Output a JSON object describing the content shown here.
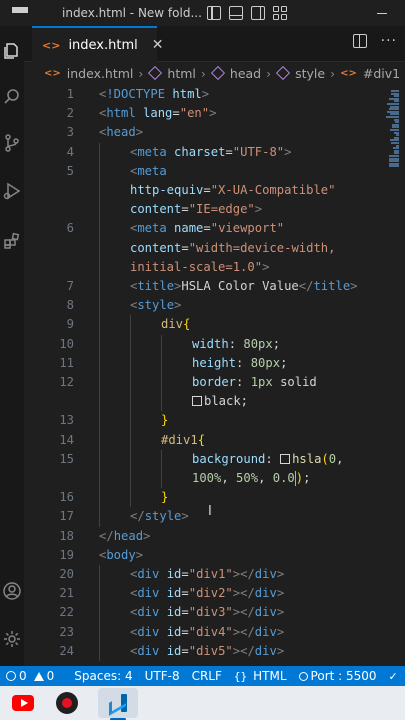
{
  "window": {
    "title": "index.html - New fold..."
  },
  "tab": {
    "label": "index.html",
    "icon": "html-file-icon",
    "close": "✕"
  },
  "breadcrumb": {
    "items": [
      "index.html",
      "html",
      "head",
      "style",
      "#div1"
    ]
  },
  "editor": {
    "lines": [
      {
        "num": "1",
        "indent": 0,
        "tokens": [
          [
            "punc",
            "<"
          ],
          [
            "tag",
            "!DOCTYPE"
          ],
          [
            "text",
            " "
          ],
          [
            "attr",
            "html"
          ],
          [
            "punc",
            ">"
          ]
        ]
      },
      {
        "num": "2",
        "indent": 0,
        "tokens": [
          [
            "punc",
            "<"
          ],
          [
            "tag",
            "html"
          ],
          [
            "text",
            " "
          ],
          [
            "attr",
            "lang"
          ],
          [
            "text",
            "="
          ],
          [
            "str",
            "\"en\""
          ],
          [
            "punc",
            ">"
          ]
        ]
      },
      {
        "num": "3",
        "indent": 0,
        "tokens": [
          [
            "punc",
            "<"
          ],
          [
            "tag",
            "head"
          ],
          [
            "punc",
            ">"
          ]
        ]
      },
      {
        "num": "4",
        "indent": 1,
        "tokens": [
          [
            "punc",
            "<"
          ],
          [
            "tag",
            "meta"
          ],
          [
            "text",
            " "
          ],
          [
            "attr",
            "charset"
          ],
          [
            "text",
            "="
          ],
          [
            "str",
            "\"UTF-8\""
          ],
          [
            "punc",
            ">"
          ]
        ]
      },
      {
        "num": "5",
        "indent": 1,
        "tokens": [
          [
            "punc",
            "<"
          ],
          [
            "tag",
            "meta"
          ]
        ]
      },
      {
        "num": "",
        "indent": 1,
        "tokens": [
          [
            "attr",
            "http-equiv"
          ],
          [
            "text",
            "="
          ],
          [
            "str",
            "\"X-UA-Compatible\""
          ]
        ]
      },
      {
        "num": "",
        "indent": 1,
        "tokens": [
          [
            "attr",
            "content"
          ],
          [
            "text",
            "="
          ],
          [
            "str",
            "\"IE=edge\""
          ],
          [
            "punc",
            ">"
          ]
        ]
      },
      {
        "num": "6",
        "indent": 1,
        "tokens": [
          [
            "punc",
            "<"
          ],
          [
            "tag",
            "meta"
          ],
          [
            "text",
            " "
          ],
          [
            "attr",
            "name"
          ],
          [
            "text",
            "="
          ],
          [
            "str",
            "\"viewport\""
          ]
        ]
      },
      {
        "num": "",
        "indent": 1,
        "tokens": [
          [
            "attr",
            "content"
          ],
          [
            "text",
            "="
          ],
          [
            "str",
            "\"width=device-width,"
          ]
        ]
      },
      {
        "num": "",
        "indent": 1,
        "tokens": [
          [
            "str",
            "initial-scale=1.0\""
          ],
          [
            "punc",
            ">"
          ]
        ]
      },
      {
        "num": "7",
        "indent": 1,
        "tokens": [
          [
            "punc",
            "<"
          ],
          [
            "tag",
            "title"
          ],
          [
            "punc",
            ">"
          ],
          [
            "text",
            "HSLA Color Value"
          ],
          [
            "punc",
            "</"
          ],
          [
            "tag",
            "title"
          ],
          [
            "punc",
            ">"
          ]
        ]
      },
      {
        "num": "8",
        "indent": 1,
        "tokens": [
          [
            "punc",
            "<"
          ],
          [
            "tag",
            "style"
          ],
          [
            "punc",
            ">"
          ]
        ]
      },
      {
        "num": "9",
        "indent": 2,
        "tokens": [
          [
            "sel",
            "div"
          ],
          [
            "brace",
            "{"
          ]
        ]
      },
      {
        "num": "10",
        "indent": 3,
        "tokens": [
          [
            "prop",
            "width"
          ],
          [
            "text",
            ": "
          ],
          [
            "num",
            "80px"
          ],
          [
            "text",
            ";"
          ]
        ]
      },
      {
        "num": "11",
        "indent": 3,
        "tokens": [
          [
            "prop",
            "height"
          ],
          [
            "text",
            ": "
          ],
          [
            "num",
            "80px"
          ],
          [
            "text",
            ";"
          ]
        ]
      },
      {
        "num": "12",
        "indent": 3,
        "tokens": [
          [
            "prop",
            "border"
          ],
          [
            "text",
            ": "
          ],
          [
            "num",
            "1px"
          ],
          [
            "text",
            " solid"
          ]
        ]
      },
      {
        "num": "",
        "indent": 3,
        "tokens": [
          [
            "swatch",
            ""
          ],
          [
            "text",
            "black;"
          ]
        ]
      },
      {
        "num": "13",
        "indent": 2,
        "tokens": [
          [
            "brace",
            "}"
          ]
        ]
      },
      {
        "num": "14",
        "indent": 2,
        "tokens": [
          [
            "sel",
            "#div1"
          ],
          [
            "brace",
            "{"
          ]
        ]
      },
      {
        "num": "15",
        "indent": 3,
        "tokens": [
          [
            "prop",
            "background"
          ],
          [
            "text",
            ": "
          ],
          [
            "swatch",
            ""
          ],
          [
            "func",
            "hsla"
          ],
          [
            "brace",
            "("
          ],
          [
            "num",
            "0"
          ],
          [
            "text",
            ","
          ]
        ]
      },
      {
        "num": "",
        "indent": 3,
        "tokens": [
          [
            "num",
            "100%"
          ],
          [
            "text",
            ", "
          ],
          [
            "num",
            "50%"
          ],
          [
            "text",
            ", "
          ],
          [
            "num",
            "0.0"
          ],
          [
            "cursor",
            ""
          ],
          [
            "brace",
            ")"
          ],
          [
            "text",
            ";"
          ]
        ]
      },
      {
        "num": "16",
        "indent": 2,
        "tokens": [
          [
            "brace",
            "}"
          ]
        ]
      },
      {
        "num": "17",
        "indent": 1,
        "tokens": [
          [
            "punc",
            "</"
          ],
          [
            "tag",
            "style"
          ],
          [
            "punc",
            ">"
          ]
        ]
      },
      {
        "num": "18",
        "indent": 0,
        "tokens": [
          [
            "punc",
            "</"
          ],
          [
            "tag",
            "head"
          ],
          [
            "punc",
            ">"
          ]
        ]
      },
      {
        "num": "19",
        "indent": 0,
        "tokens": [
          [
            "punc",
            "<"
          ],
          [
            "tag",
            "body"
          ],
          [
            "punc",
            ">"
          ]
        ]
      },
      {
        "num": "20",
        "indent": 1,
        "tokens": [
          [
            "punc",
            "<"
          ],
          [
            "tag",
            "div"
          ],
          [
            "text",
            " "
          ],
          [
            "attr",
            "id"
          ],
          [
            "text",
            "="
          ],
          [
            "str",
            "\"div1\""
          ],
          [
            "punc",
            ">"
          ],
          [
            "punc",
            "</"
          ],
          [
            "tag",
            "div"
          ],
          [
            "punc",
            ">"
          ]
        ]
      },
      {
        "num": "21",
        "indent": 1,
        "tokens": [
          [
            "punc",
            "<"
          ],
          [
            "tag",
            "div"
          ],
          [
            "text",
            " "
          ],
          [
            "attr",
            "id"
          ],
          [
            "text",
            "="
          ],
          [
            "str",
            "\"div2\""
          ],
          [
            "punc",
            ">"
          ],
          [
            "punc",
            "</"
          ],
          [
            "tag",
            "div"
          ],
          [
            "punc",
            ">"
          ]
        ]
      },
      {
        "num": "22",
        "indent": 1,
        "tokens": [
          [
            "punc",
            "<"
          ],
          [
            "tag",
            "div"
          ],
          [
            "text",
            " "
          ],
          [
            "attr",
            "id"
          ],
          [
            "text",
            "="
          ],
          [
            "str",
            "\"div3\""
          ],
          [
            "punc",
            ">"
          ],
          [
            "punc",
            "</"
          ],
          [
            "tag",
            "div"
          ],
          [
            "punc",
            ">"
          ]
        ]
      },
      {
        "num": "23",
        "indent": 1,
        "tokens": [
          [
            "punc",
            "<"
          ],
          [
            "tag",
            "div"
          ],
          [
            "text",
            " "
          ],
          [
            "attr",
            "id"
          ],
          [
            "text",
            "="
          ],
          [
            "str",
            "\"div4\""
          ],
          [
            "punc",
            ">"
          ],
          [
            "punc",
            "</"
          ],
          [
            "tag",
            "div"
          ],
          [
            "punc",
            ">"
          ]
        ]
      },
      {
        "num": "24",
        "indent": 1,
        "tokens": [
          [
            "punc",
            "<"
          ],
          [
            "tag",
            "div"
          ],
          [
            "text",
            " "
          ],
          [
            "attr",
            "id"
          ],
          [
            "text",
            "="
          ],
          [
            "str",
            "\"div5\""
          ],
          [
            "punc",
            ">"
          ],
          [
            "punc",
            "</"
          ],
          [
            "tag",
            "div"
          ],
          [
            "punc",
            ">"
          ]
        ]
      }
    ]
  },
  "statusbar": {
    "errors": "0",
    "warnings": "0",
    "spaces": "Spaces: 4",
    "encoding": "UTF-8",
    "eol": "CRLF",
    "language": "HTML",
    "port": "Port : 5500"
  },
  "taskbar": {
    "apps": [
      "youtube-icon",
      "screen-recorder-icon",
      "vscode-icon"
    ]
  },
  "colors": {
    "statusbar": "#0078d4",
    "editor_bg": "#1f1f1f",
    "tag": "#569cd6",
    "string": "#ce9178",
    "attribute": "#9cdcfe"
  }
}
